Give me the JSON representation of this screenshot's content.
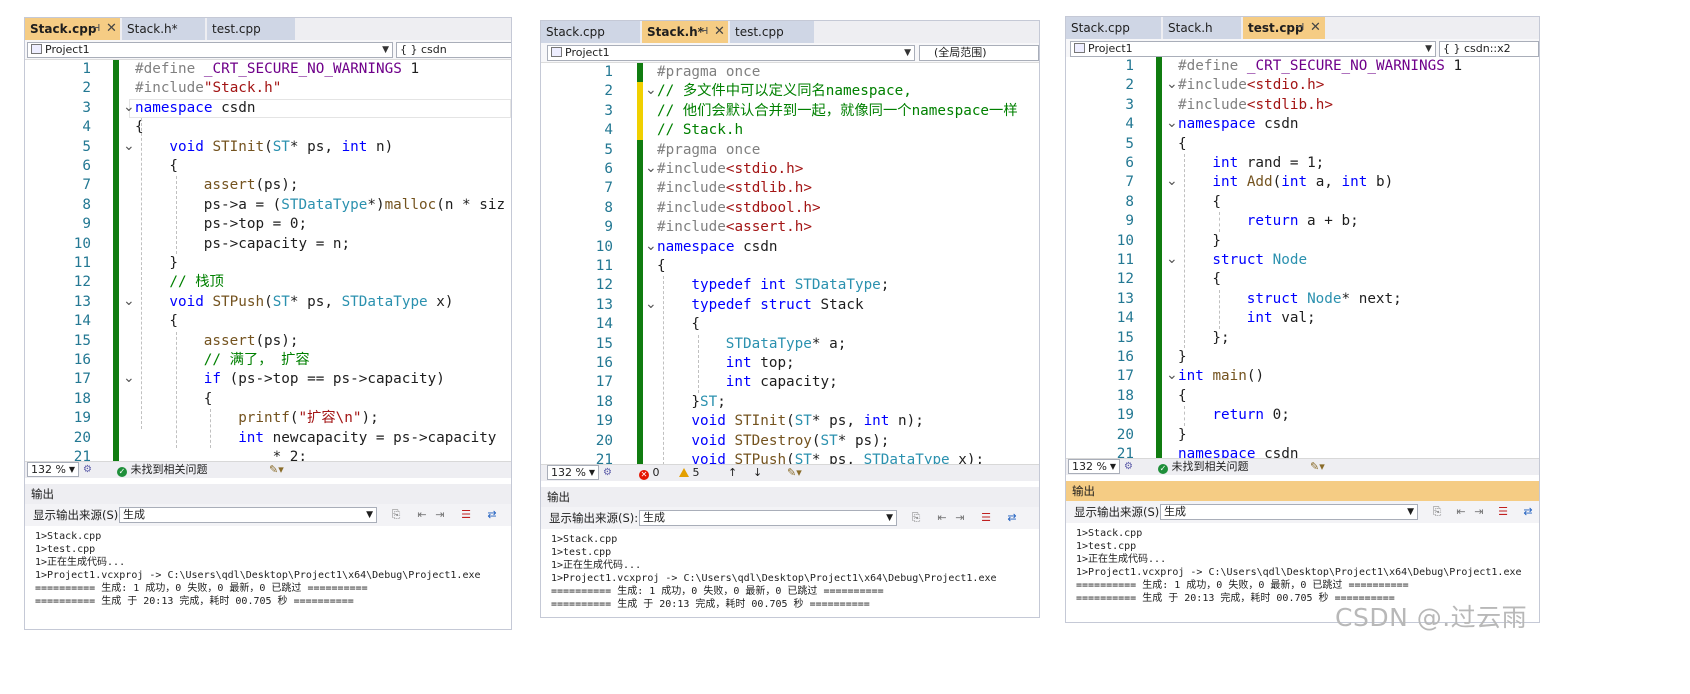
{
  "windows": [
    {
      "tabs": [
        {
          "label": "Stack.cpp",
          "active": true,
          "pin": "⊣",
          "close": "✕"
        },
        {
          "label": "Stack.h*",
          "active": false
        },
        {
          "label": "test.cpp",
          "active": false
        }
      ],
      "project_dropdown": "Project1",
      "scope_dropdown": "{ } csdn",
      "zoom": "132 %",
      "status_message": "未找到相关问题",
      "lines": [
        {
          "n": "1",
          "text": "#define _CRT_SECURE_NO_WARNINGS 1"
        },
        {
          "n": "2",
          "text": "#include\"Stack.h\""
        },
        {
          "n": "3",
          "text": "namespace csdn"
        },
        {
          "n": "4",
          "text": "{"
        },
        {
          "n": "5",
          "text": "void STInit(ST* ps, int n)"
        },
        {
          "n": "6",
          "text": "{"
        },
        {
          "n": "7",
          "text": "assert(ps);"
        },
        {
          "n": "8",
          "text": "ps->a = (STDataType*)malloc(n * siz"
        },
        {
          "n": "9",
          "text": "ps->top = 0;"
        },
        {
          "n": "10",
          "text": "ps->capacity = n;"
        },
        {
          "n": "11",
          "text": "}"
        },
        {
          "n": "12",
          "text": "// 栈顶"
        },
        {
          "n": "13",
          "text": "void STPush(ST* ps, STDataType x)"
        },
        {
          "n": "14",
          "text": "{"
        },
        {
          "n": "15",
          "text": "assert(ps);"
        },
        {
          "n": "16",
          "text": "// 满了， 扩容"
        },
        {
          "n": "17",
          "text": "if (ps->top == ps->capacity)"
        },
        {
          "n": "18",
          "text": "{"
        },
        {
          "n": "19",
          "text": "printf(\"扩容\\n\");"
        },
        {
          "n": "20",
          "text": "int newcapacity = ps->capacity"
        },
        {
          "n": "21",
          "text": "* 2;"
        }
      ],
      "output": {
        "title": "输出",
        "source_label": "显示输出来源(S):",
        "source_value": "生成",
        "lines": [
          "1>Stack.cpp",
          "1>test.cpp",
          "1>正在生成代码...",
          "1>Project1.vcxproj -> C:\\Users\\qdl\\Desktop\\Project1\\x64\\Debug\\Project1.exe",
          "========== 生成: 1 成功，0 失败，0 最新，0 已跳过 ==========",
          "========== 生成 于 20:13 完成，耗时 00.705 秒 =========="
        ]
      }
    },
    {
      "tabs": [
        {
          "label": "Stack.cpp",
          "active": false
        },
        {
          "label": "Stack.h*",
          "active": true,
          "pin": "⊣",
          "close": "✕"
        },
        {
          "label": "test.cpp",
          "active": false
        }
      ],
      "project_dropdown": "Project1",
      "scope_dropdown": "(全局范围)",
      "zoom": "132 %",
      "errors": "0",
      "warnings": "5",
      "lines": [
        {
          "n": "1",
          "text": "#pragma once"
        },
        {
          "n": "2",
          "text": "// 多文件中可以定义同名namespace,"
        },
        {
          "n": "3",
          "text": "// 他们会默认合并到一起，就像同一个namespace一样"
        },
        {
          "n": "4",
          "text": "// Stack.h"
        },
        {
          "n": "5",
          "text": "#pragma once"
        },
        {
          "n": "6",
          "text": "#include<stdio.h>"
        },
        {
          "n": "7",
          "text": "#include<stdlib.h>"
        },
        {
          "n": "8",
          "text": "#include<stdbool.h>"
        },
        {
          "n": "9",
          "text": "#include<assert.h>"
        },
        {
          "n": "10",
          "text": "namespace csdn"
        },
        {
          "n": "11",
          "text": "{"
        },
        {
          "n": "12",
          "text": "typedef int STDataType;"
        },
        {
          "n": "13",
          "text": "typedef struct Stack"
        },
        {
          "n": "14",
          "text": "{"
        },
        {
          "n": "15",
          "text": "STDataType* a;"
        },
        {
          "n": "16",
          "text": "int top;"
        },
        {
          "n": "17",
          "text": "int capacity;"
        },
        {
          "n": "18",
          "text": "}ST;"
        },
        {
          "n": "19",
          "text": "void STInit(ST* ps, int n);"
        },
        {
          "n": "20",
          "text": "void STDestroy(ST* ps);"
        },
        {
          "n": "21",
          "text": "void STPush(ST* ps, STDataType x);"
        }
      ],
      "output": {
        "title": "输出",
        "source_label": "显示输出来源(S):",
        "source_value": "生成",
        "lines": [
          "1>Stack.cpp",
          "1>test.cpp",
          "1>正在生成代码...",
          "1>Project1.vcxproj -> C:\\Users\\qdl\\Desktop\\Project1\\x64\\Debug\\Project1.exe",
          "========== 生成: 1 成功，0 失败，0 最新，0 已跳过 ==========",
          "========== 生成 于 20:13 完成，耗时 00.705 秒 =========="
        ]
      }
    },
    {
      "tabs": [
        {
          "label": "Stack.cpp",
          "active": false
        },
        {
          "label": "Stack.h",
          "active": false
        },
        {
          "label": "test.cpp",
          "active": true,
          "pin": "⊣",
          "close": "✕"
        }
      ],
      "project_dropdown": "Project1",
      "scope_dropdown": "{ } csdn::x2",
      "zoom": "132 %",
      "status_message": "未找到相关问题",
      "lines": [
        {
          "n": "1",
          "text": "#define _CRT_SECURE_NO_WARNINGS 1"
        },
        {
          "n": "2",
          "text": "#include<stdio.h>"
        },
        {
          "n": "3",
          "text": "#include<stdlib.h>"
        },
        {
          "n": "4",
          "text": "namespace csdn"
        },
        {
          "n": "5",
          "text": "{"
        },
        {
          "n": "6",
          "text": "int rand = 1;"
        },
        {
          "n": "7",
          "text": "int Add(int a, int b)"
        },
        {
          "n": "8",
          "text": "{"
        },
        {
          "n": "9",
          "text": "return a + b;"
        },
        {
          "n": "10",
          "text": "}"
        },
        {
          "n": "11",
          "text": "struct Node"
        },
        {
          "n": "12",
          "text": "{"
        },
        {
          "n": "13",
          "text": "struct Node* next;"
        },
        {
          "n": "14",
          "text": "int val;"
        },
        {
          "n": "15",
          "text": "};"
        },
        {
          "n": "16",
          "text": "}"
        },
        {
          "n": "17",
          "text": "int main()"
        },
        {
          "n": "18",
          "text": "{"
        },
        {
          "n": "19",
          "text": "return 0;"
        },
        {
          "n": "20",
          "text": "}"
        },
        {
          "n": "21",
          "text": "namespace csdn"
        }
      ],
      "output": {
        "title": "输出",
        "source_label": "显示输出来源(S):",
        "source_value": "生成",
        "lines": [
          "1>Stack.cpp",
          "1>test.cpp",
          "1>正在生成代码...",
          "1>Project1.vcxproj -> C:\\Users\\qdl\\Desktop\\Project1\\x64\\Debug\\Project1.exe",
          "========== 生成: 1 成功，0 失败，0 最新，0 已跳过 ==========",
          "========== 生成 于 20:13 完成，耗时 00.705 秒 =========="
        ]
      }
    }
  ],
  "watermark": "CSDN @.过云雨",
  "colors": {
    "active_tab": "#f5cc84",
    "inactive_tab": "#cfd6e5",
    "keyword": "#0000ff",
    "comment": "#008000",
    "string": "#a31515",
    "type": "#2b91af",
    "function": "#74531f",
    "macro": "#6f008a",
    "line_number": "#237893",
    "change_bar": "#107c10"
  },
  "icons": [
    "pin-icon",
    "close-icon",
    "dropdown-arrow-icon",
    "project-icon",
    "check-icon",
    "error-icon",
    "warning-icon",
    "broom-icon",
    "arrow-up-icon",
    "arrow-down-icon"
  ]
}
